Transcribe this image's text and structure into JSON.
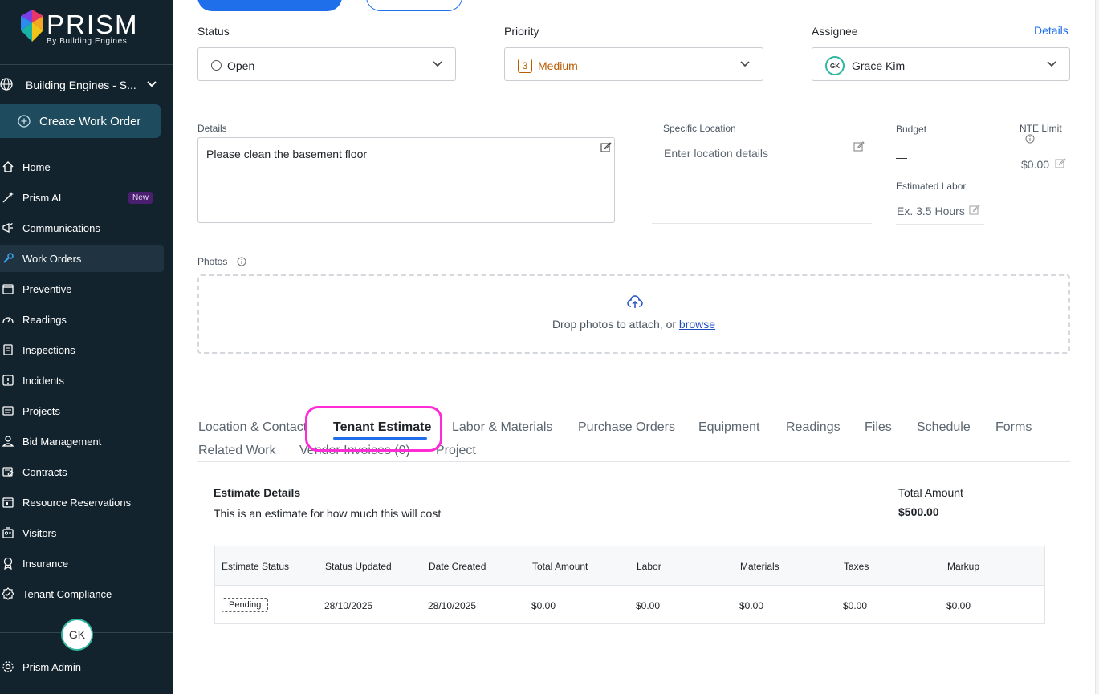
{
  "sidebar": {
    "logo": {
      "word": "PRISM",
      "sub": "By Building Engines"
    },
    "building": "Building Engines - S...",
    "create_label": "Create Work Order",
    "items": [
      {
        "label": "Home",
        "icon": "home-icon"
      },
      {
        "label": "Prism AI",
        "icon": "magic-wand-icon",
        "badge": "New"
      },
      {
        "label": "Communications",
        "icon": "megaphone-icon"
      },
      {
        "label": "Work Orders",
        "icon": "wrench-icon",
        "active": true
      },
      {
        "label": "Preventive",
        "icon": "calendar-icon"
      },
      {
        "label": "Readings",
        "icon": "gauge-icon"
      },
      {
        "label": "Inspections",
        "icon": "clipboard-icon"
      },
      {
        "label": "Incidents",
        "icon": "alert-icon"
      },
      {
        "label": "Projects",
        "icon": "folder-icon"
      },
      {
        "label": "Bid Management",
        "icon": "person-icon"
      },
      {
        "label": "Contracts",
        "icon": "contract-icon"
      },
      {
        "label": "Resource Reservations",
        "icon": "calendar-grid-icon"
      },
      {
        "label": "Visitors",
        "icon": "badge-icon"
      },
      {
        "label": "Insurance",
        "icon": "award-icon"
      },
      {
        "label": "Tenant Compliance",
        "icon": "check-badge-icon"
      }
    ],
    "avatar": "GK",
    "admin_label": "Prism Admin"
  },
  "form": {
    "status_label": "Status",
    "status_value": "Open",
    "priority_label": "Priority",
    "priority_number": "3",
    "priority_value": "Medium",
    "assignee_label": "Assignee",
    "details_link": "Details",
    "assignee_initials": "GK",
    "assignee_value": "Grace Kim",
    "details_label": "Details",
    "details_value": "Please clean the basement floor",
    "location_label": "Specific Location",
    "location_placeholder": "Enter location details",
    "budget_label": "Budget",
    "budget_value": "—",
    "nte_label": "NTE Limit",
    "nte_value": "$0.00",
    "labor_label": "Estimated Labor",
    "labor_placeholder": "Ex. 3.5 Hours",
    "photos_label": "Photos",
    "drop_text": "Drop photos to attach, or ",
    "browse_text": "browse"
  },
  "tabs": [
    "Location & Contact",
    "Tenant Estimate",
    "Labor & Materials",
    "Purchase Orders",
    "Equipment",
    "Readings",
    "Files",
    "Schedule",
    "Forms",
    "Related Work",
    "Vendor Invoices (0)",
    "Project"
  ],
  "active_tab": "Tenant Estimate",
  "estimate": {
    "title": "Estimate Details",
    "description": "This is an estimate for how much this will cost",
    "total_label": "Total Amount",
    "total_value": "$500.00",
    "columns": [
      "Estimate Status",
      "Status Updated",
      "Date Created",
      "Total Amount",
      "Labor",
      "Materials",
      "Taxes",
      "Markup"
    ],
    "row": [
      "Pending",
      "28/10/2025",
      "28/10/2025",
      "$0.00",
      "$0.00",
      "$0.00",
      "$0.00",
      "$0.00"
    ]
  },
  "colors": {
    "sidebar_bg": "#13232e",
    "accent": "#1f6feb",
    "highlight": "#ff2bd6",
    "priority": "#b85c00"
  }
}
